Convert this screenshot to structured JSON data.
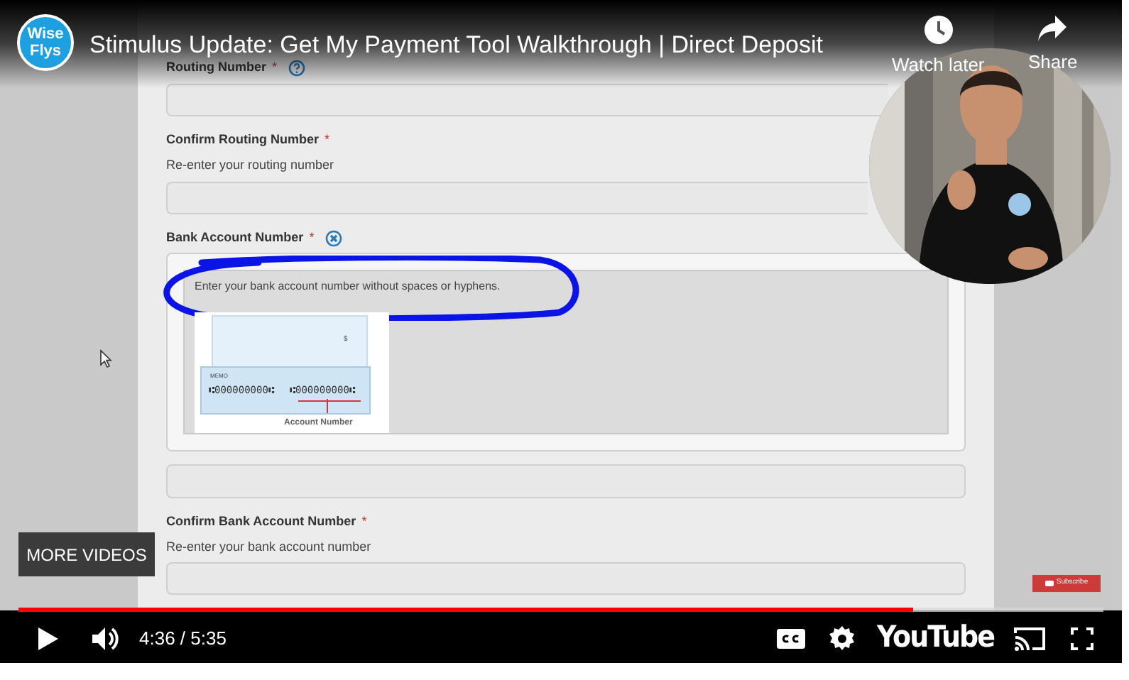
{
  "player": {
    "title": "Stimulus Update: Get My Payment Tool Walkthrough | Direct Deposit",
    "channel_logo": {
      "line_1": "Wise",
      "line_2": "Flys"
    },
    "actions": [
      {
        "kind": "clock",
        "label": "Watch later"
      },
      {
        "kind": "share",
        "label": "Share"
      }
    ]
  },
  "video_frame": {
    "form": {
      "fields": [
        {
          "kind": "help",
          "label": "Routing Number",
          "required_mark": "*"
        },
        {
          "kind": "plain",
          "label": "Confirm Routing Number",
          "required_mark": "*",
          "hint": "Re-enter your routing number"
        },
        {
          "kind": "close",
          "label": "Bank Account Number",
          "required_mark": "*",
          "tooltip": {
            "text": "Enter your bank account number without spaces or hyphens.",
            "check": {
              "dollar": "$",
              "memo": "MEMO",
              "routing": "⑆000000000⑆",
              "account": "⑆000000000⑆",
              "caption": "Account Number"
            }
          }
        },
        {
          "kind": "plain",
          "label": "Confirm Bank Account Number",
          "required_mark": "*",
          "hint": "Re-enter your bank account number"
        }
      ]
    },
    "more_videos": "MORE VIDEOS",
    "subscribe": "Subscribe"
  },
  "controls": {
    "progress": {
      "level": 0.824
    },
    "time": "4:36 / 5:35",
    "brand": "YouTube"
  }
}
